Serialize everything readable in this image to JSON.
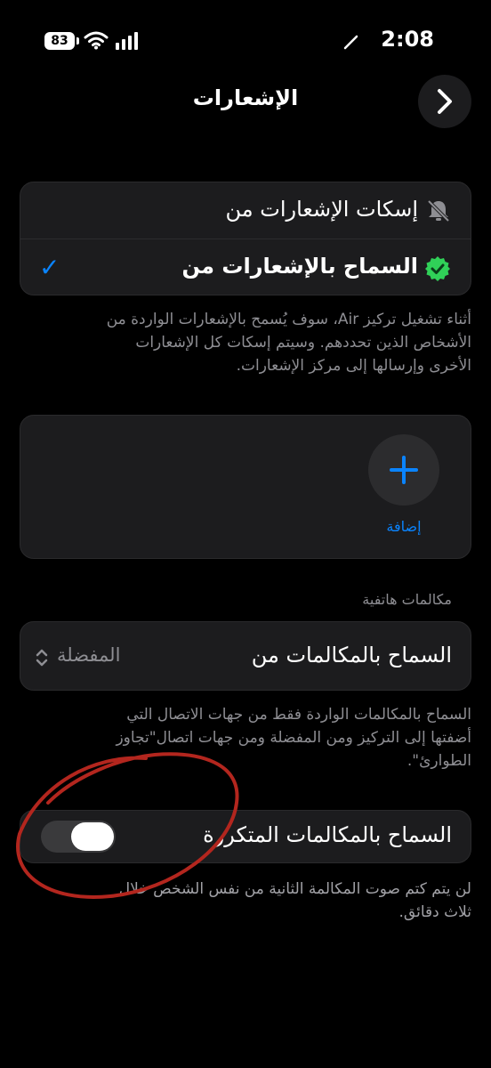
{
  "status_bar": {
    "time": "2:08",
    "battery": "83"
  },
  "header": {
    "title": "الإشعارات"
  },
  "notify_options": {
    "silence_label": "إسكات الإشعارات من",
    "allow_label": "السماح بالإشعارات من",
    "check": "✓"
  },
  "notify_description": [
    "أثناء تشغيل تركيز Air، سوف يُسمح بالإشعارات الواردة من",
    "الأشخاص الذين تحددهم. وسيتم إسكات كل الإشعارات",
    "الأخرى وإرسالها إلى مركز الإشعارات."
  ],
  "people": {
    "add_label": "إضافة"
  },
  "calls": {
    "section_label": "مكالمات هاتفية",
    "allow_calls_label": "السماح بالمكالمات من",
    "allow_calls_value": "المفضلة",
    "description": [
      "السماح بالمكالمات الواردة فقط من جهات الاتصال التي",
      "أضفتها إلى التركيز ومن المفضلة ومن جهات اتصال\"تجاوز",
      "الطوارئ\"."
    ],
    "repeated_label": "السماح بالمكالمات المتكررة",
    "repeated_enabled": true,
    "repeated_description": [
      "لن يتم كتم صوت المكالمة الثانية من نفس الشخص خلال",
      "ثلاث دقائق."
    ]
  },
  "colors": {
    "accent": "#0a84ff",
    "check_badge": "#30d158",
    "annotation": "#b3261e"
  }
}
